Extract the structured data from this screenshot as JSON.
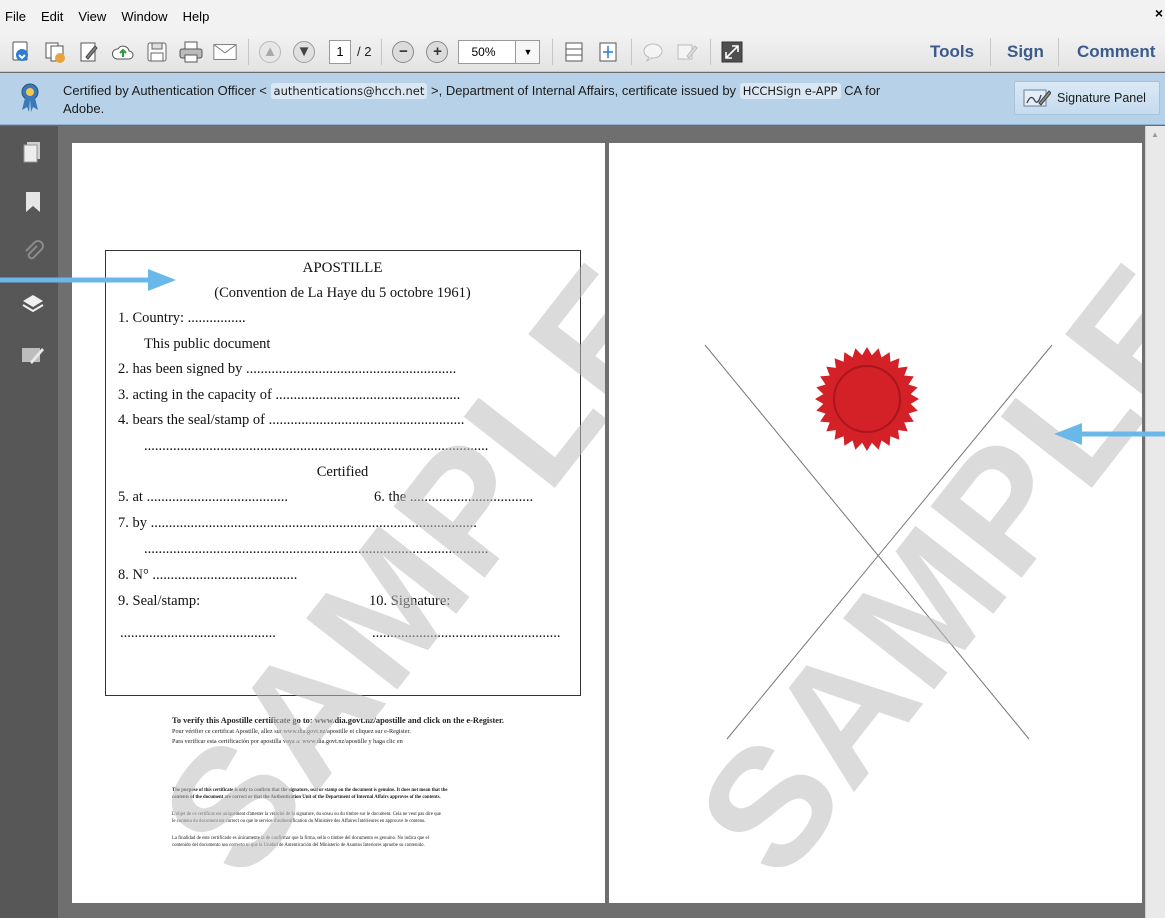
{
  "menu": {
    "items": [
      "File",
      "Edit",
      "View",
      "Window",
      "Help"
    ],
    "close": "×"
  },
  "toolbar": {
    "page_current": "1",
    "page_total": "/ 2",
    "zoom": "50%",
    "tab_tools": "Tools",
    "tab_sign": "Sign",
    "tab_comment": "Comment"
  },
  "certbar": {
    "text_1": "Certified by Authentication Officer <",
    "email": "authentications@hcch.net",
    "text_2": ">, Department of Internal Affairs, certificate issued by",
    "issuer": "HCCHSign e-APP",
    "text_3": "CA for",
    "text_4": "Adobe.",
    "signature_panel": "Signature Panel"
  },
  "apostille": {
    "title": "APOSTILLE",
    "subtitle": "(Convention de La Haye du 5 octobre 1961)",
    "line_1": "1.  Country:  ................",
    "line_1b": "This public document",
    "line_2": "2.  has been signed by ..........................................................",
    "line_3": "3.  acting in the capacity of ...................................................",
    "line_4": "4.  bears the seal/stamp of ......................................................",
    "line_4b": "...............................................................................................",
    "certified": "Certified",
    "line_5": "5.  at .......................................",
    "line_6": "6.  the ..................................",
    "line_7": "7.  by ..........................................................................................",
    "line_7b": "...............................................................................................",
    "line_8": "8.  N° ........................................",
    "line_9": "9.  Seal/stamp:",
    "line_10": "10.  Signature:",
    "line_9b": "...........................................",
    "line_10b": "...................................................."
  },
  "footer": {
    "verify_en": "To verify this Apostille certificate go to: www.dia.govt.nz/apostille and click on the e-Register.",
    "verify_fr": "Pour vérifier ce certificat Apostille, allez sur www.dia.govt.nz/apostille et cliquez sur e-Register.",
    "verify_es": "Para verificar esta certificación por apostilla vaya a: www.dia.govt.nz/apostille y haga clic en",
    "purpose_en_1": "The purpose of this certificate is only to confirm that the signature, seal or stamp on the document is genuine. It does not mean that the",
    "purpose_en_2": "contents of the document are correct or that the Authentication Unit of the Department of Internal Affairs approves of the contents.",
    "purpose_fr_1": "L'objet de ce certificat est uniquement d'attester la véracité de la signature, du sceau ou du timbre sur le document. Cela ne veut pas dire que",
    "purpose_fr_2": "le contenu du document est correct ou que le service d'authentification du Ministère des Affaires Intérieures en approuve le contenu.",
    "purpose_es_1": "La finalidad de este certificado es únicamente la de confirmar que la firma, sello o timbre del documento es genuino. No indica que el",
    "purpose_es_2": "contenido del documento sea correcto ni que la Unidad de Autenticación del Ministerio de Asuntos Interiores apruebe su contenido."
  },
  "watermark": "SAMPLE",
  "colors": {
    "arrow": "#6ab8ea",
    "seal": "#d42027",
    "tab_text": "#3c5a8a",
    "certbar_bg": "#b7d2e8"
  }
}
